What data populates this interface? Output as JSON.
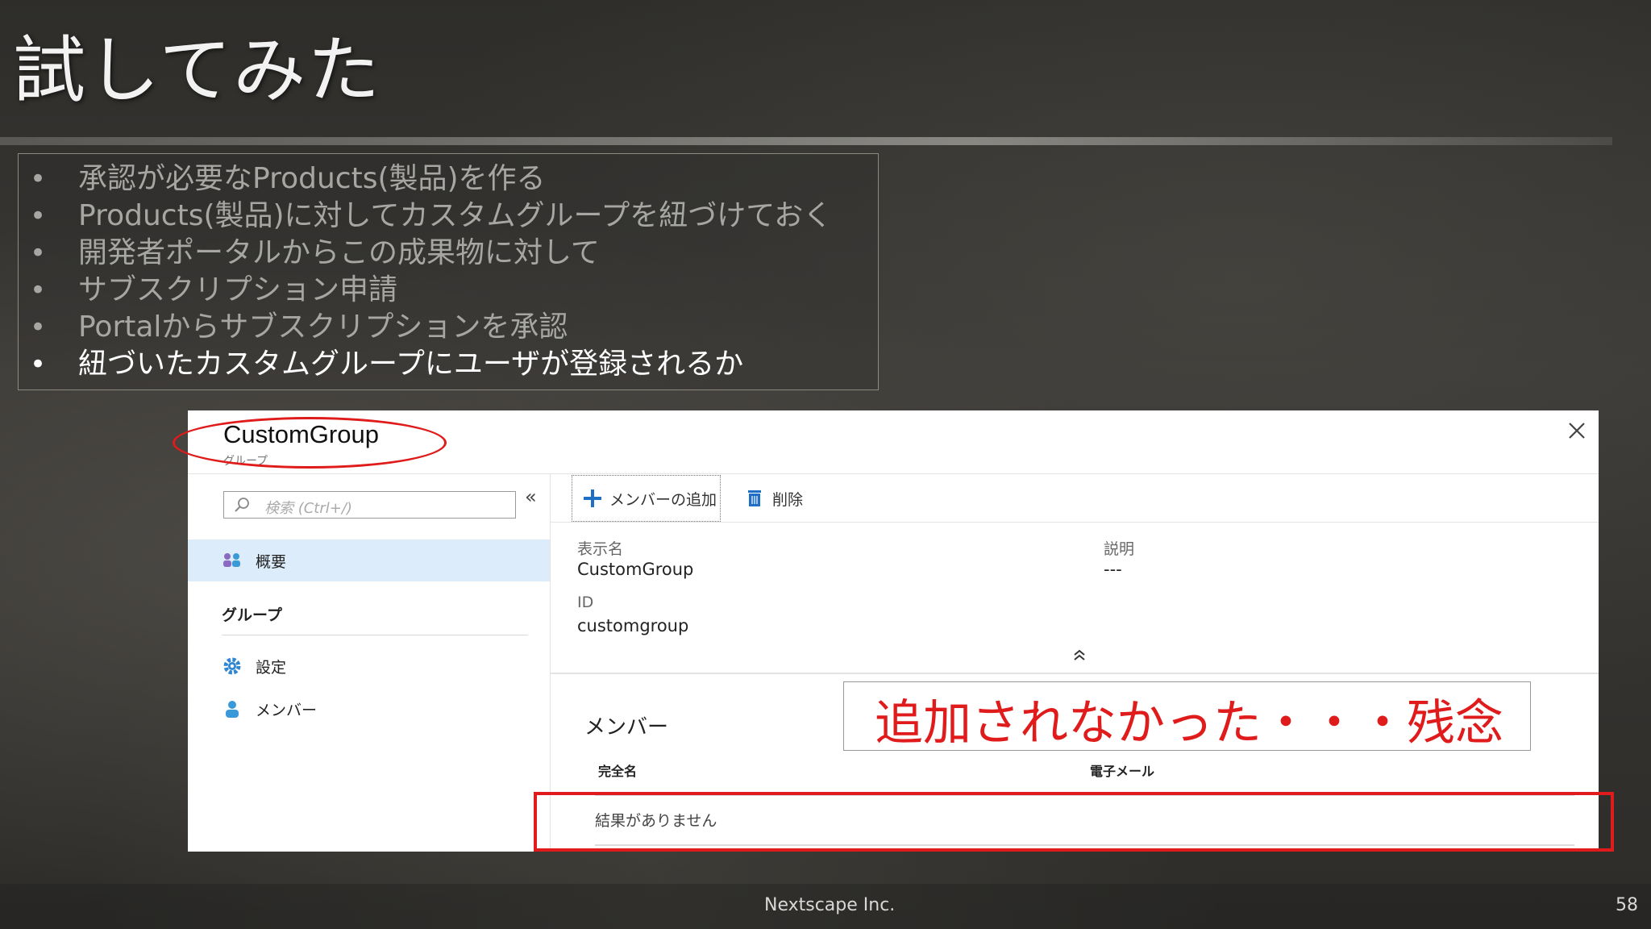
{
  "slide": {
    "title": "試してみた",
    "bullets": [
      "承認が必要なProducts(製品)を作る",
      "Products(製品)に対してカスタムグループを紐づけておく",
      "開発者ポータルからこの成果物に対して",
      "サブスクリプション申請",
      "Portalからサブスクリプションを承認",
      "紐づいたカスタムグループにユーザが登録されるか"
    ],
    "active_bullet_index": 5
  },
  "panel": {
    "title": "CustomGroup",
    "subtitle": "グループ",
    "search_placeholder": "検索 (Ctrl+/)",
    "collapse_icon": "«",
    "nav": {
      "overview": "概要",
      "section": "グループ",
      "settings": "設定",
      "members": "メンバー"
    },
    "toolbar": {
      "add_member": "メンバーの追加",
      "delete": "削除"
    },
    "essentials": {
      "display_name_label": "表示名",
      "display_name_value": "CustomGroup",
      "description_label": "説明",
      "description_value": "---",
      "id_label": "ID",
      "id_value": "customgroup"
    },
    "members": {
      "heading": "メンバー",
      "columns": [
        "完全名",
        "電子メール"
      ],
      "empty_message": "結果がありません"
    }
  },
  "annotation": {
    "callout": "追加されなかった・・・残念",
    "accent_color": "#e01b1b"
  },
  "footer": {
    "company": "Nextscape Inc.",
    "page_number": "58"
  }
}
